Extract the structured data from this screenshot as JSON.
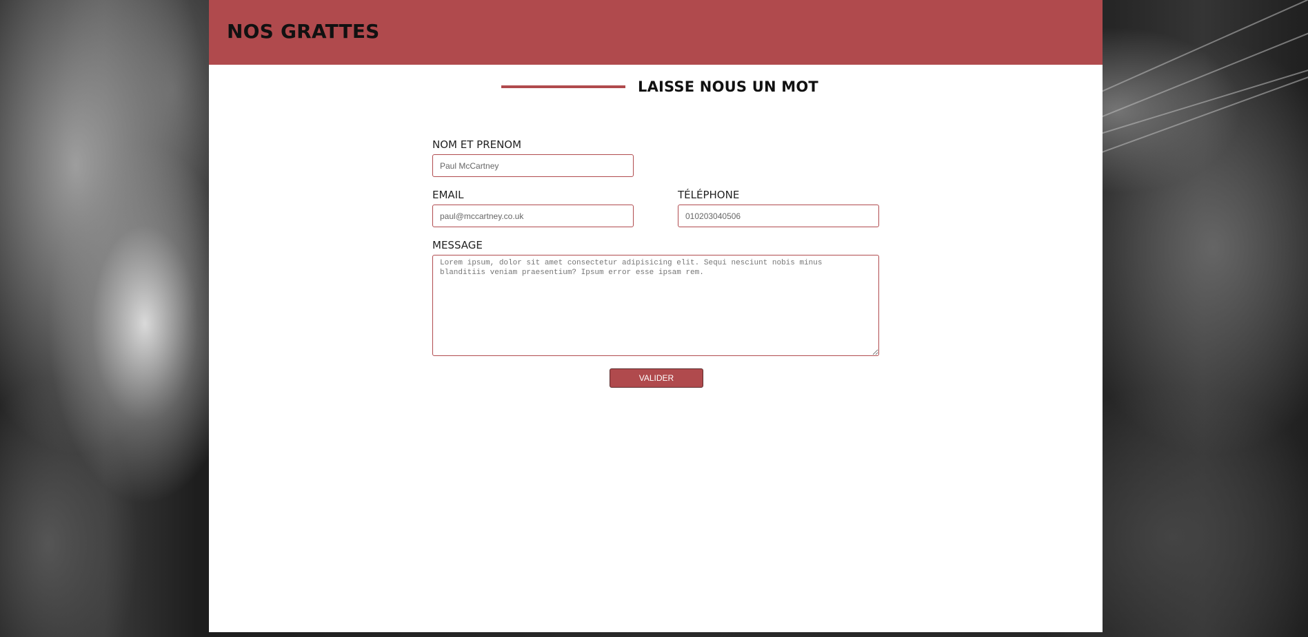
{
  "header": {
    "brand": "NOS GRATTES"
  },
  "section": {
    "title": "LAISSE NOUS UN MOT"
  },
  "form": {
    "name": {
      "label": "NOM ET PRENOM",
      "placeholder": "Paul McCartney"
    },
    "email": {
      "label": "EMAIL",
      "placeholder": "paul@mccartney.co.uk"
    },
    "phone": {
      "label": "TÉLÉPHONE",
      "placeholder": "010203040506"
    },
    "message": {
      "label": "MESSAGE",
      "placeholder": "Lorem ipsum, dolor sit amet consectetur adipisicing elit. Sequi nesciunt nobis minus blanditiis veniam praesentium? Ipsum error esse ipsam rem."
    },
    "submit_label": "VALIDER"
  },
  "colors": {
    "accent": "#b04a4d",
    "text": "#111111",
    "panel": "#ffffff"
  }
}
